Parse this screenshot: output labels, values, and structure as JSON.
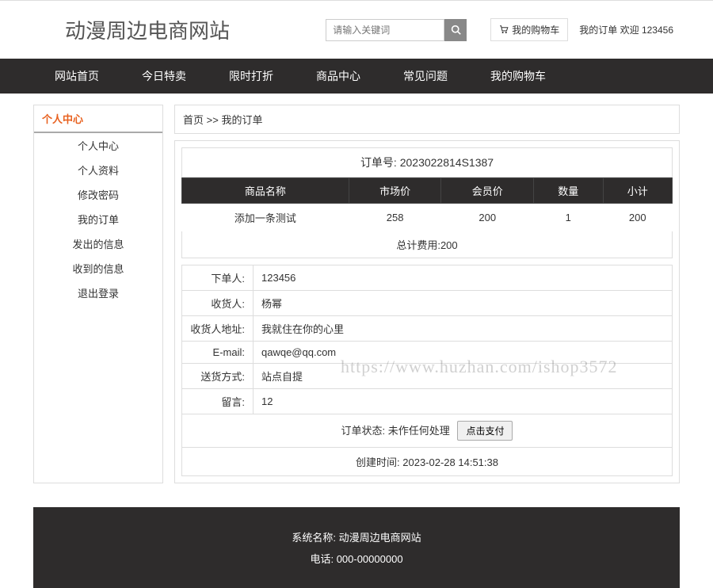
{
  "header": {
    "site_title": "动漫周边电商网站",
    "search_placeholder": "请输入关键词",
    "cart_label": "我的购物车",
    "orders_label": "我的订单",
    "welcome": "欢迎",
    "username": "123456"
  },
  "nav": [
    "网站首页",
    "今日特卖",
    "限时打折",
    "商品中心",
    "常见问题",
    "我的购物车"
  ],
  "sidebar": {
    "title": "个人中心",
    "items": [
      "个人中心",
      "个人资料",
      "修改密码",
      "我的订单",
      "发出的信息",
      "收到的信息",
      "退出登录"
    ]
  },
  "breadcrumb": {
    "home": "首页",
    "sep": ">>",
    "current": "我的订单"
  },
  "order": {
    "number_label": "订单号:",
    "number": "2023022814S1387",
    "columns": [
      "商品名称",
      "市场价",
      "会员价",
      "数量",
      "小计"
    ],
    "rows": [
      {
        "name": "添加一条测试",
        "market": "258",
        "member": "200",
        "qty": "1",
        "subtotal": "200"
      }
    ],
    "total_label": "总计费用:",
    "total": "200",
    "info": [
      {
        "label": "下单人:",
        "value": "123456"
      },
      {
        "label": "收货人:",
        "value": "杨幂"
      },
      {
        "label": "收货人地址:",
        "value": "我就住在你的心里"
      },
      {
        "label": "E-mail:",
        "value": "qawqe@qq.com"
      },
      {
        "label": "送货方式:",
        "value": "站点自提"
      },
      {
        "label": "留言:",
        "value": "12"
      }
    ],
    "status_label": "订单状态:",
    "status_value": "未作任何处理",
    "pay_button": "点击支付",
    "time_label": "创建时间:",
    "time_value": "2023-02-28 14:51:38"
  },
  "footer": {
    "sys_label": "系统名称:",
    "sys_value": "动漫周边电商网站",
    "tel_label": "电话:",
    "tel_value": "000-00000000"
  },
  "watermark": "https://www.huzhan.com/ishop3572"
}
